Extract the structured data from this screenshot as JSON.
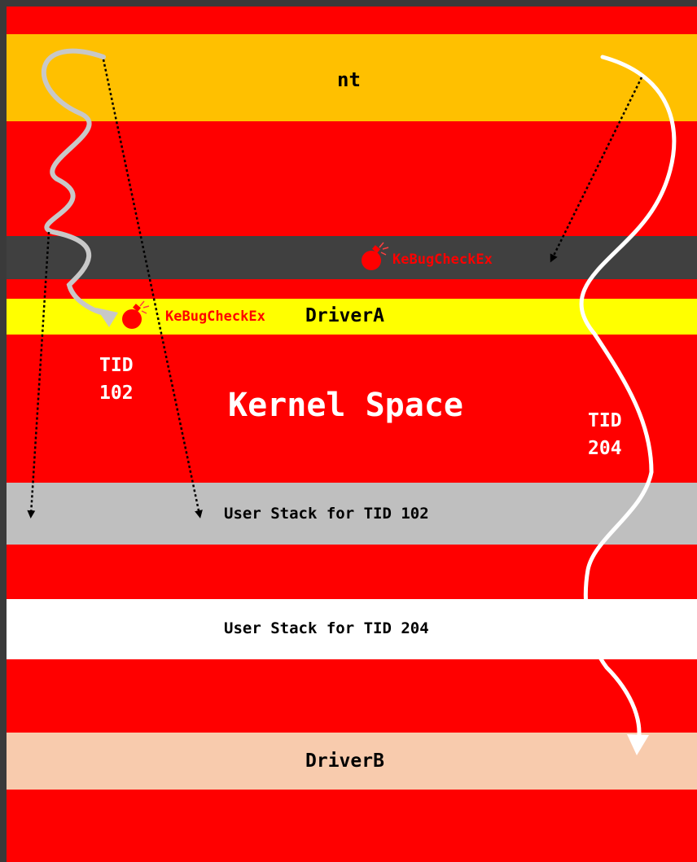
{
  "colors": {
    "frame": "#3a3a3a",
    "kernel": "#ff0000",
    "nt": "#ffc000",
    "driver_a": "#ffff00",
    "user_stack_102": "#bfbfbf",
    "user_stack_204": "#ffffff",
    "driver_b": "#f8cbad",
    "bugcheck_text": "#ff0000",
    "thread_102_arrow": "#c8c8c8",
    "thread_204_arrow": "#ffffff"
  },
  "modules": {
    "nt": "nt",
    "driver_a": "DriverA",
    "driver_b": "DriverB"
  },
  "regions": {
    "kernel_space": "Kernel Space",
    "user_stack_102": "User Stack for TID 102",
    "user_stack_204": "User Stack for TID 204"
  },
  "bugchecks": {
    "upper": "KeBugCheckEx",
    "lower": "KeBugCheckEx"
  },
  "threads": {
    "t102": {
      "label": "TID",
      "id": "102"
    },
    "t204": {
      "label": "TID",
      "id": "204"
    }
  }
}
